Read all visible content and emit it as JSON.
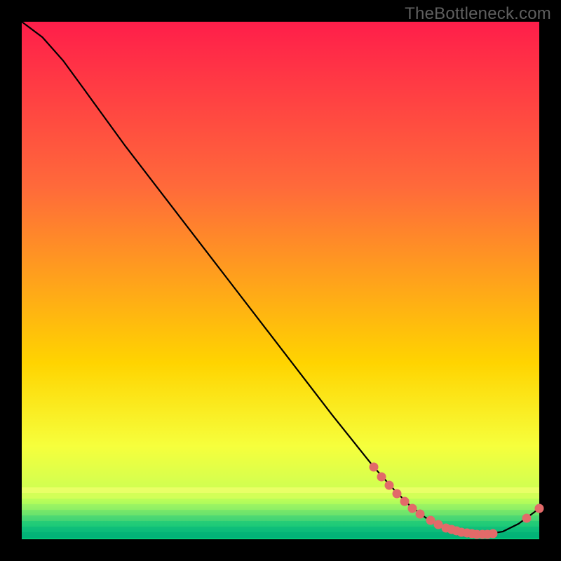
{
  "watermark": "TheBottleneck.com",
  "gradient": {
    "top_color": "#ff1e4a",
    "mid_upper": "#ff6a3a",
    "mid": "#ffd400",
    "mid_lower": "#f6ff3c",
    "green_start": "#c8ff56",
    "green_deep": "#00c679"
  },
  "marker_color": "#e26a69",
  "line_color": "#000000",
  "chart_data": {
    "type": "line",
    "title": "",
    "xlabel": "",
    "ylabel": "",
    "xlim": [
      0,
      100
    ],
    "ylim": [
      0,
      100
    ],
    "series": [
      {
        "name": "curve",
        "x": [
          0,
          4,
          8,
          12,
          20,
          30,
          40,
          50,
          60,
          68,
          72,
          75,
          78,
          80,
          82,
          84,
          86,
          88,
          90,
          93,
          96,
          99,
          100
        ],
        "y": [
          100,
          97,
          92.5,
          87,
          76,
          63,
          50,
          37,
          24,
          14,
          9.5,
          6.5,
          4.2,
          3.0,
          2.2,
          1.6,
          1.2,
          1.0,
          1.0,
          1.5,
          3.0,
          5.2,
          6.0
        ]
      }
    ],
    "annotations_markers": [
      {
        "x": 68,
        "y": 14.0
      },
      {
        "x": 69.5,
        "y": 12.1
      },
      {
        "x": 71,
        "y": 10.4
      },
      {
        "x": 72.5,
        "y": 8.8
      },
      {
        "x": 74,
        "y": 7.3
      },
      {
        "x": 75.5,
        "y": 6.0
      },
      {
        "x": 77,
        "y": 4.9
      },
      {
        "x": 79,
        "y": 3.6
      },
      {
        "x": 80.5,
        "y": 2.8
      },
      {
        "x": 82,
        "y": 2.2
      },
      {
        "x": 83,
        "y": 1.9
      },
      {
        "x": 84,
        "y": 1.6
      },
      {
        "x": 85,
        "y": 1.35
      },
      {
        "x": 86,
        "y": 1.2
      },
      {
        "x": 87,
        "y": 1.08
      },
      {
        "x": 88,
        "y": 1.0
      },
      {
        "x": 89,
        "y": 1.0
      },
      {
        "x": 90,
        "y": 1.0
      },
      {
        "x": 91,
        "y": 1.1
      },
      {
        "x": 97.5,
        "y": 4.0
      },
      {
        "x": 100,
        "y": 6.0
      }
    ]
  }
}
